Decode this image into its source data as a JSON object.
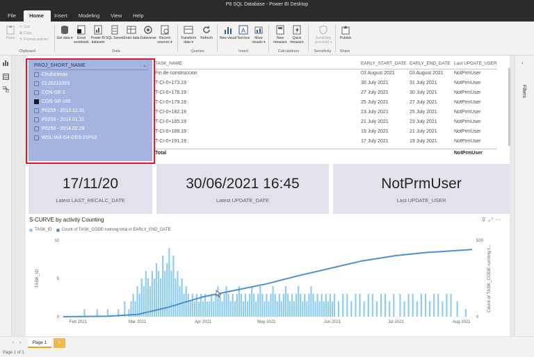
{
  "app": {
    "title": "P6 SQL Database - Power BI Desktop"
  },
  "menu": {
    "tabs": [
      "File",
      "Home",
      "Insert",
      "Modeling",
      "View",
      "Help"
    ]
  },
  "ribbon": {
    "clipboard": {
      "paste": "Paste",
      "cut": "Cut",
      "copy": "Copy",
      "format_painter": "Format painter",
      "label": "Clipboard"
    },
    "data": {
      "label": "Data",
      "buttons": [
        "Get data ▾",
        "Excel workbook",
        "Power BI datasets",
        "SQL Server",
        "Enter data",
        "Dataverse",
        "Recent sources ▾"
      ]
    },
    "queries": {
      "label": "Queries",
      "buttons": [
        "Transform data ▾",
        "Refresh"
      ]
    },
    "insert": {
      "label": "Insert",
      "buttons": [
        "New visual",
        "Text box",
        "More visuals ▾"
      ]
    },
    "calculations": {
      "label": "Calculations",
      "buttons": [
        "New measure",
        "Quick measure"
      ]
    },
    "sensitivity": {
      "label": "Sensitivity",
      "buttons": [
        "Sensitivity (preview) ▾"
      ]
    },
    "share": {
      "label": "Share",
      "buttons": [
        "Publish"
      ]
    }
  },
  "slicer": {
    "header": "PROJ_SHORT_NAME",
    "items": [
      {
        "label": "Chulucanas",
        "checked": false
      },
      {
        "label": "CL20210209",
        "checked": false
      },
      {
        "label": "CON-SR-1",
        "checked": false
      },
      {
        "label": "CON-SR-165",
        "checked": true
      },
      {
        "label": "P0258 - 2013.12.31",
        "checked": false
      },
      {
        "label": "P0258 - 2014.01.31",
        "checked": false
      },
      {
        "label": "P0258 - 2014.02.28",
        "checked": false
      },
      {
        "label": "WDL-W3-G4-DES-21P02",
        "checked": false
      }
    ]
  },
  "table": {
    "headers": [
      "TASK_NAME",
      "EARLY_START_DATE",
      "EARLY_END_DATE",
      "Last UPDATE_USER"
    ],
    "rows": [
      [
        "Fin de construccion",
        "03 August 2021",
        "03 August 2021",
        "NotPrmUser"
      ],
      [
        "T-CI-0+173.19",
        "30 July 2021",
        "31 July 2021",
        "NotPrmUser"
      ],
      [
        "T-CI-0+176.19",
        "27 July 2021",
        "30 July 2021",
        "NotPrmUser"
      ],
      [
        "T-CI-0+179.19",
        "25 July 2021",
        "27 July 2021",
        "NotPrmUser"
      ],
      [
        "T-CI-0+182.19",
        "23 July 2021",
        "25 July 2021",
        "NotPrmUser"
      ],
      [
        "T-CI-0+185.19",
        "21 July 2021",
        "23 July 2021",
        "NotPrmUser"
      ],
      [
        "T-CI-0+188.19",
        "19 July 2021",
        "21 July 2021",
        "NotPrmUser"
      ],
      [
        "T-CI-0+191.19",
        "17 July 2021",
        "19 July 2021",
        "NotPrmUser"
      ]
    ],
    "total_label": "Total",
    "total_user": "NotPrmUser"
  },
  "cards": [
    {
      "value": "17/11/20",
      "label": "Latest LAST_RECALC_DATE"
    },
    {
      "value": "30/06/2021 16:45",
      "label": "Latest UPDATE_DATE"
    },
    {
      "value": "NotPrmUser",
      "label": "Last UPDATE_USER"
    }
  ],
  "chart_data": {
    "type": "bar",
    "title": "S-CURVE by activity Counting",
    "series": [
      {
        "name": "TASK_ID",
        "color": "#8fcdf0"
      },
      {
        "name": "Count of TASK_CODE running total in EARLY_END_DATE",
        "color": "#4a8fd4"
      }
    ],
    "ylabel": "TASK_ID",
    "y2label": "Count of TASK_CODE running t...",
    "ylim": [
      0,
      10
    ],
    "y_ticks": [
      0,
      5,
      10
    ],
    "y2lim": [
      0,
      500
    ],
    "y2_ticks": [
      0,
      500
    ],
    "x_tick_labels": [
      "Feb 2021",
      "Mar 2021",
      "Apr 2021",
      "May 2021",
      "Jun 2021",
      "Jul 2021",
      "Aug 2021"
    ],
    "x_tick_dates": [
      "2021-02-01",
      "2021-03-01",
      "2021-04-01",
      "2021-05-01",
      "2021-06-01",
      "2021-07-01",
      "2021-08-01"
    ],
    "x_range": [
      "2021-01-25",
      "2021-08-06"
    ],
    "bars": [
      [
        "2021-02-04",
        1
      ],
      [
        "2021-02-10",
        1
      ],
      [
        "2021-02-15",
        1
      ],
      [
        "2021-02-20",
        1
      ],
      [
        "2021-02-23",
        2
      ],
      [
        "2021-02-25",
        1
      ],
      [
        "2021-02-26",
        2
      ],
      [
        "2021-02-27",
        3
      ],
      [
        "2021-02-28",
        2
      ],
      [
        "2021-03-01",
        4
      ],
      [
        "2021-03-02",
        3
      ],
      [
        "2021-03-03",
        5
      ],
      [
        "2021-03-04",
        4
      ],
      [
        "2021-03-05",
        6
      ],
      [
        "2021-03-06",
        5
      ],
      [
        "2021-03-07",
        4
      ],
      [
        "2021-03-08",
        6
      ],
      [
        "2021-03-09",
        5
      ],
      [
        "2021-03-10",
        7
      ],
      [
        "2021-03-11",
        6
      ],
      [
        "2021-03-12",
        5
      ],
      [
        "2021-03-13",
        8
      ],
      [
        "2021-03-14",
        6
      ],
      [
        "2021-03-15",
        7
      ],
      [
        "2021-03-16",
        9
      ],
      [
        "2021-03-17",
        6
      ],
      [
        "2021-03-18",
        8
      ],
      [
        "2021-03-19",
        5
      ],
      [
        "2021-03-20",
        6
      ],
      [
        "2021-03-21",
        4
      ],
      [
        "2021-03-22",
        5
      ],
      [
        "2021-03-23",
        3
      ],
      [
        "2021-03-24",
        4
      ],
      [
        "2021-03-25",
        3
      ],
      [
        "2021-03-26",
        2
      ],
      [
        "2021-03-27",
        3
      ],
      [
        "2021-03-28",
        2
      ],
      [
        "2021-03-29",
        3
      ],
      [
        "2021-03-30",
        2
      ],
      [
        "2021-03-31",
        3
      ],
      [
        "2021-04-01",
        2
      ],
      [
        "2021-04-02",
        3
      ],
      [
        "2021-04-03",
        2
      ],
      [
        "2021-04-04",
        2
      ],
      [
        "2021-04-05",
        3
      ],
      [
        "2021-04-06",
        2
      ],
      [
        "2021-04-07",
        3
      ],
      [
        "2021-04-08",
        4
      ],
      [
        "2021-04-09",
        3
      ],
      [
        "2021-04-10",
        2
      ],
      [
        "2021-04-11",
        3
      ],
      [
        "2021-04-12",
        4
      ],
      [
        "2021-04-13",
        3
      ],
      [
        "2021-04-14",
        2
      ],
      [
        "2021-04-15",
        3
      ],
      [
        "2021-04-16",
        2
      ],
      [
        "2021-04-17",
        3
      ],
      [
        "2021-04-18",
        4
      ],
      [
        "2021-04-19",
        3
      ],
      [
        "2021-04-20",
        2
      ],
      [
        "2021-04-21",
        3
      ],
      [
        "2021-04-22",
        2
      ],
      [
        "2021-04-23",
        3
      ],
      [
        "2021-04-24",
        4
      ],
      [
        "2021-04-25",
        3
      ],
      [
        "2021-04-26",
        2
      ],
      [
        "2021-04-27",
        3
      ],
      [
        "2021-04-28",
        4
      ],
      [
        "2021-04-29",
        3
      ],
      [
        "2021-04-30",
        2
      ],
      [
        "2021-05-01",
        3
      ],
      [
        "2021-05-02",
        2
      ],
      [
        "2021-05-03",
        3
      ],
      [
        "2021-05-04",
        4
      ],
      [
        "2021-05-05",
        3
      ],
      [
        "2021-05-06",
        2
      ],
      [
        "2021-05-07",
        3
      ],
      [
        "2021-05-08",
        2
      ],
      [
        "2021-05-09",
        3
      ],
      [
        "2021-05-10",
        4
      ],
      [
        "2021-05-11",
        3
      ],
      [
        "2021-05-12",
        2
      ],
      [
        "2021-05-13",
        3
      ],
      [
        "2021-05-14",
        2
      ],
      [
        "2021-05-15",
        3
      ],
      [
        "2021-05-16",
        4
      ],
      [
        "2021-05-17",
        3
      ],
      [
        "2021-05-18",
        2
      ],
      [
        "2021-05-19",
        3
      ],
      [
        "2021-05-20",
        2
      ],
      [
        "2021-05-21",
        3
      ],
      [
        "2021-05-22",
        4
      ],
      [
        "2021-05-23",
        3
      ],
      [
        "2021-05-24",
        2
      ],
      [
        "2021-05-25",
        3
      ],
      [
        "2021-05-26",
        2
      ],
      [
        "2021-05-27",
        3
      ],
      [
        "2021-05-28",
        2
      ],
      [
        "2021-05-29",
        3
      ],
      [
        "2021-05-30",
        2
      ],
      [
        "2021-05-31",
        3
      ],
      [
        "2021-06-01",
        2
      ],
      [
        "2021-06-02",
        3
      ],
      [
        "2021-06-04",
        2
      ],
      [
        "2021-06-06",
        3
      ],
      [
        "2021-06-08",
        3
      ],
      [
        "2021-06-10",
        2
      ],
      [
        "2021-06-12",
        3
      ],
      [
        "2021-06-14",
        3
      ],
      [
        "2021-06-16",
        2
      ],
      [
        "2021-06-18",
        3
      ],
      [
        "2021-06-20",
        3
      ],
      [
        "2021-06-22",
        2
      ],
      [
        "2021-06-24",
        3
      ],
      [
        "2021-06-26",
        3
      ],
      [
        "2021-06-28",
        2
      ],
      [
        "2021-06-30",
        3
      ],
      [
        "2021-07-03",
        3
      ],
      [
        "2021-07-05",
        2
      ],
      [
        "2021-07-07",
        3
      ],
      [
        "2021-07-09",
        3
      ],
      [
        "2021-07-11",
        2
      ],
      [
        "2021-07-13",
        3
      ],
      [
        "2021-07-15",
        3
      ],
      [
        "2021-07-17",
        2
      ],
      [
        "2021-07-19",
        3
      ],
      [
        "2021-07-21",
        3
      ],
      [
        "2021-07-23",
        2
      ],
      [
        "2021-07-25",
        3
      ],
      [
        "2021-07-27",
        3
      ],
      [
        "2021-07-30",
        2
      ],
      [
        "2021-08-03",
        1
      ]
    ],
    "curve": [
      [
        "2021-01-25",
        0
      ],
      [
        "2021-02-15",
        3
      ],
      [
        "2021-03-01",
        15
      ],
      [
        "2021-03-15",
        60
      ],
      [
        "2021-04-01",
        130
      ],
      [
        "2021-04-15",
        170
      ],
      [
        "2021-05-01",
        215
      ],
      [
        "2021-05-15",
        265
      ],
      [
        "2021-06-01",
        320
      ],
      [
        "2021-06-15",
        365
      ],
      [
        "2021-07-01",
        400
      ],
      [
        "2021-07-15",
        420
      ],
      [
        "2021-08-01",
        435
      ],
      [
        "2021-08-06",
        440
      ]
    ]
  },
  "pages": {
    "tabs": [
      "Page 1"
    ],
    "add": "+",
    "count": "Page 1 of 1"
  },
  "panes": {
    "filters": "Filters"
  }
}
